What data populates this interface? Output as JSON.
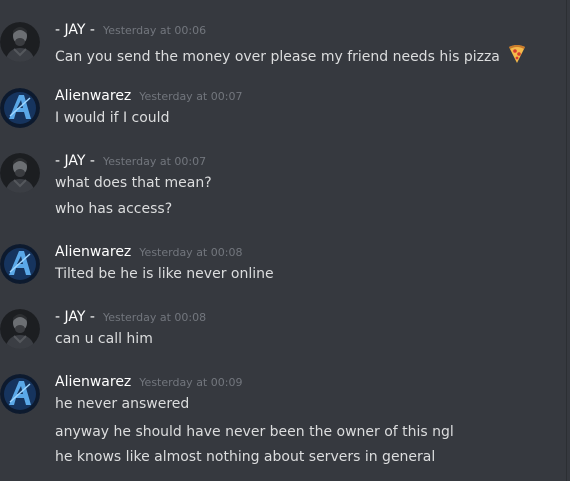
{
  "messages": [
    {
      "author": "- JAY -",
      "timestamp": "Yesterday at 00:06",
      "avatar": "jay-avatar",
      "lines": [
        "Can you send the money over please my friend needs his pizza"
      ],
      "emoji": "pizza-emoji"
    },
    {
      "author": "Alienwarez",
      "timestamp": "Yesterday at 00:07",
      "avatar": "alienwarez-avatar",
      "lines": [
        "I would if I could"
      ]
    },
    {
      "author": "- JAY -",
      "timestamp": "Yesterday at 00:07",
      "avatar": "jay-avatar",
      "lines": [
        "what does that mean?",
        "who has access?"
      ]
    },
    {
      "author": "Alienwarez",
      "timestamp": "Yesterday at 00:08",
      "avatar": "alienwarez-avatar",
      "lines": [
        "Tilted be he is like never online"
      ]
    },
    {
      "author": "- JAY -",
      "timestamp": "Yesterday at 00:08",
      "avatar": "jay-avatar",
      "lines": [
        "can u call him"
      ]
    },
    {
      "author": "Alienwarez",
      "timestamp": "Yesterday at 00:09",
      "avatar": "alienwarez-avatar",
      "lines": [
        "he never answered",
        "anyway he should have never been the owner of this ngl",
        "he knows like almost nothing about servers in general"
      ]
    }
  ],
  "colors": {
    "background": "#36393f",
    "author": "#ffffff",
    "timestamp": "#72767d",
    "text": "#dcddde"
  }
}
